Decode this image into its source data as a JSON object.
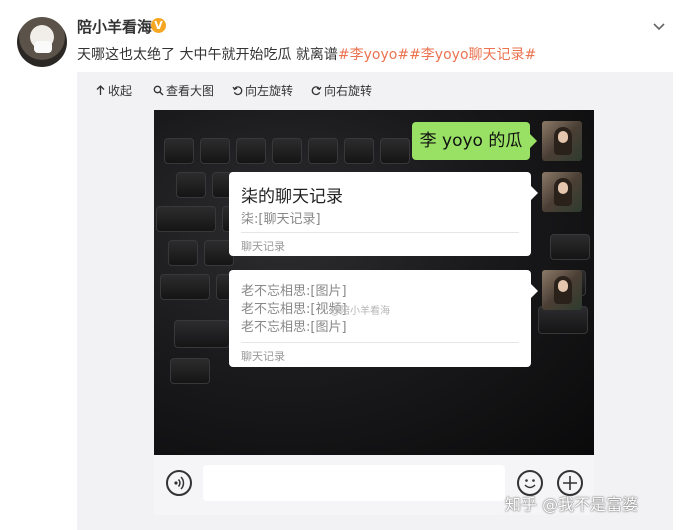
{
  "post": {
    "username": "陪小羊看海",
    "verified_badge": "V",
    "text_plain": "天哪这也太绝了 大中午就开始吃瓜 就离谱",
    "tags": [
      "#李yoyo#",
      "#李yoyo聊天记录#"
    ]
  },
  "toolbar": [
    {
      "icon": "collapse-icon",
      "label": "收起"
    },
    {
      "icon": "zoom-icon",
      "label": "查看大图"
    },
    {
      "icon": "rotate-left-icon",
      "label": "向左旋转"
    },
    {
      "icon": "rotate-right-icon",
      "label": "向右旋转"
    }
  ],
  "chat": {
    "green_bubble": "李 yoyo 的瓜",
    "card1": {
      "title": "柒的聊天记录",
      "line": "柒:[聊天记录]",
      "footer": "聊天记录"
    },
    "card2": {
      "lines": [
        "老不忘相思:[图片]",
        "老不忘相思:[视频]",
        "老不忘相思:[图片]"
      ],
      "footer": "聊天记录"
    },
    "watermark": "@陪小羊看海"
  },
  "credit": "知乎 @我不是富婆",
  "colors": {
    "tag": "#eb7350",
    "bubble_green": "#98e165",
    "badge": "#f5a623"
  }
}
